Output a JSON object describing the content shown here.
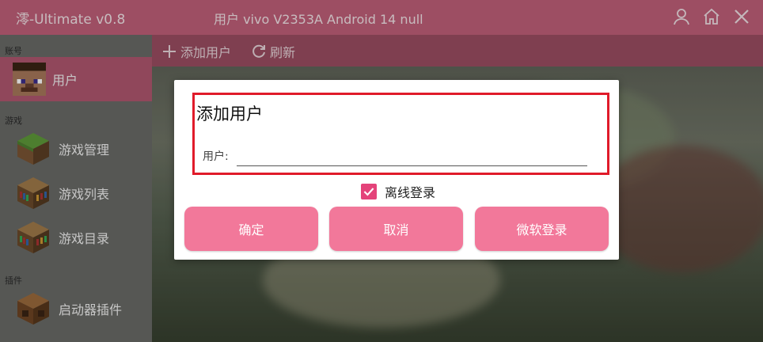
{
  "titlebar": {
    "app_title": "澪-Ultimate v0.8",
    "device_info": "用户   vivo V2353A Android 14 null",
    "icons": [
      "user-icon",
      "home-icon",
      "close-icon"
    ]
  },
  "sidebar": {
    "section_account": "账号",
    "account_item": "用户",
    "section_game": "游戏",
    "game_items": [
      "游戏管理",
      "游戏列表",
      "游戏目录"
    ],
    "section_plugin": "插件",
    "plugin_items": [
      "启动器插件"
    ]
  },
  "toolbar": {
    "add_user": "添加用户",
    "refresh": "刷新"
  },
  "dialog": {
    "title": "添加用户",
    "user_label": "用户:",
    "user_value": "",
    "offline_label": "离线登录",
    "offline_checked": true,
    "confirm": "确定",
    "cancel": "取消",
    "microsoft_login": "微软登录"
  },
  "colors": {
    "titlebar": "#c06079",
    "accent": "#f2789a",
    "checkbox": "#e4437a",
    "highlight_border": "#e01b2a"
  }
}
